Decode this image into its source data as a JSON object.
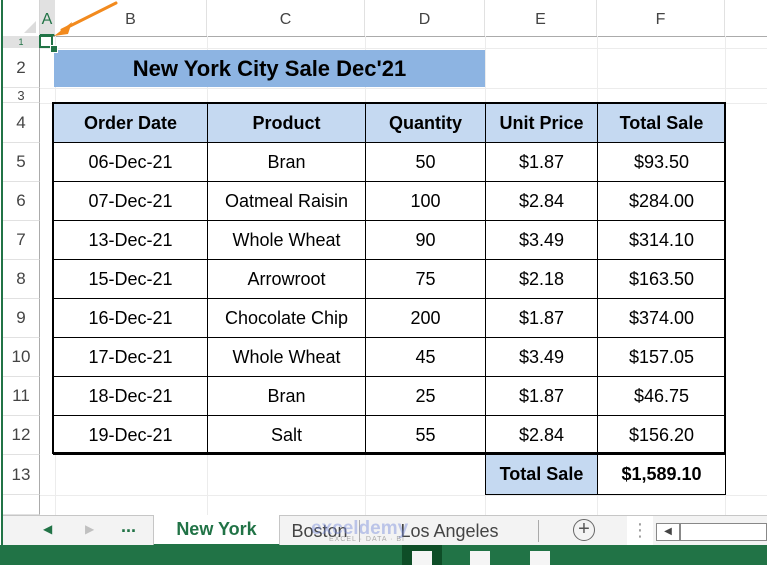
{
  "column_headers": [
    "A",
    "B",
    "C",
    "D",
    "E",
    "F"
  ],
  "row_headers": [
    "1",
    "2",
    "3",
    "4",
    "5",
    "6",
    "7",
    "8",
    "9",
    "10",
    "11",
    "12",
    "13"
  ],
  "selected_cell": "A1",
  "title": "New York City Sale Dec'21",
  "table": {
    "headers": [
      "Order Date",
      "Product",
      "Quantity",
      "Unit Price",
      "Total Sale"
    ],
    "rows": [
      [
        "06-Dec-21",
        "Bran",
        "50",
        "$1.87",
        "$93.50"
      ],
      [
        "07-Dec-21",
        "Oatmeal Raisin",
        "100",
        "$2.84",
        "$284.00"
      ],
      [
        "13-Dec-21",
        "Whole Wheat",
        "90",
        "$3.49",
        "$314.10"
      ],
      [
        "15-Dec-21",
        "Arrowroot",
        "75",
        "$2.18",
        "$163.50"
      ],
      [
        "16-Dec-21",
        "Chocolate Chip",
        "200",
        "$1.87",
        "$374.00"
      ],
      [
        "17-Dec-21",
        "Whole Wheat",
        "45",
        "$3.49",
        "$157.05"
      ],
      [
        "18-Dec-21",
        "Bran",
        "25",
        "$1.87",
        "$46.75"
      ],
      [
        "19-Dec-21",
        "Salt",
        "55",
        "$2.84",
        "$156.20"
      ]
    ],
    "total_label": "Total Sale",
    "total_value": "$1,589.10"
  },
  "sheet_tabs": {
    "prev_icon": "◀",
    "next_icon": "▶",
    "more": "...",
    "tabs": [
      "New York",
      "Boston",
      "Los Angeles"
    ],
    "active_tab": "New York",
    "add_icon": "+",
    "splitter_icon": "⋮",
    "scroll_left_icon": "◀"
  },
  "watermark": {
    "brand": "exceldemy",
    "tagline": "EXCEL · DATA · BI"
  },
  "colors": {
    "accent": "#217346",
    "title_fill": "#8db4e2",
    "header_fill": "#c5d9f1",
    "arrow": "#f28a1e"
  }
}
